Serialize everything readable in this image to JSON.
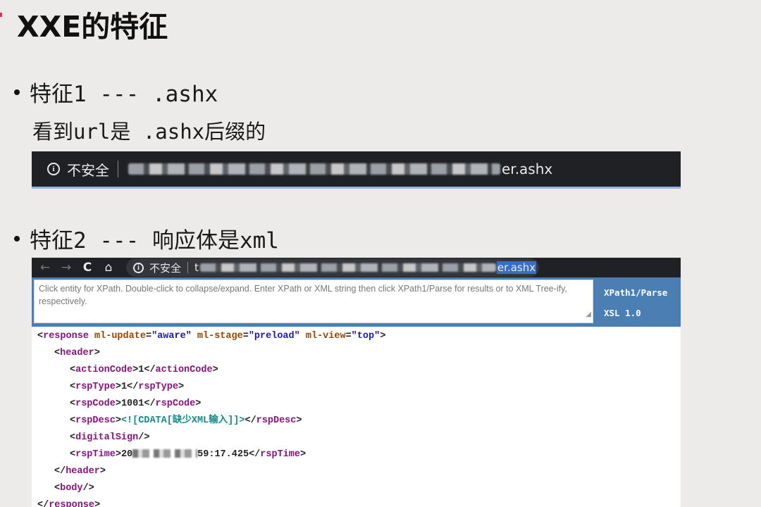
{
  "slide": {
    "title": "XXE的特征",
    "bullet1": "特征1 --- .ashx",
    "bullet1_sub": "看到url是 .ashx后缀的",
    "bullet2": "特征2 --- 响应体是xml"
  },
  "address_bar_1": {
    "security_label": "不安全",
    "url_suffix": "er.ashx"
  },
  "browser2": {
    "nav": {
      "back": "←",
      "forward": "→",
      "reload": "C",
      "home": "⌂"
    },
    "security_label": "不安全",
    "url_lead": "t",
    "url_suffix": "er.ashx",
    "xpath_placeholder": "Click entity for XPath. Double-click to collapse/expand. Enter XPath or XML string then click XPath1/Parse for results or to XML Tree-ify, respectively.",
    "btn_xpath": "XPath1/Parse",
    "btn_xsl": "XSL 1.0"
  },
  "xml": {
    "root_tag": "response",
    "attrs": [
      {
        "name": "ml-update",
        "value": "\"aware\""
      },
      {
        "name": "ml-stage",
        "value": "\"preload\""
      },
      {
        "name": "ml-view",
        "value": "\"top\""
      }
    ],
    "header_tag": "header",
    "fields": {
      "actionCode": {
        "tag": "actionCode",
        "value": "1"
      },
      "rspType": {
        "tag": "rspType",
        "value": "1"
      },
      "rspCode": {
        "tag": "rspCode",
        "value": "1001"
      },
      "rspDesc": {
        "tag": "rspDesc",
        "cdata": "<![CDATA[缺少XML输入]]>"
      },
      "digitalSign": {
        "tag": "digitalSign"
      },
      "rspTime": {
        "tag": "rspTime",
        "value_start": "20",
        "value_end": "59:17.425"
      }
    },
    "body_tag": "body"
  },
  "colors": {
    "slide_bg": "#ecebea",
    "dark_bar": "#202124",
    "xpath_panel": "#4b7fb4",
    "tag": "#881280",
    "attr": "#994500",
    "val": "#1a1aa6",
    "cdata": "#138a8a"
  }
}
